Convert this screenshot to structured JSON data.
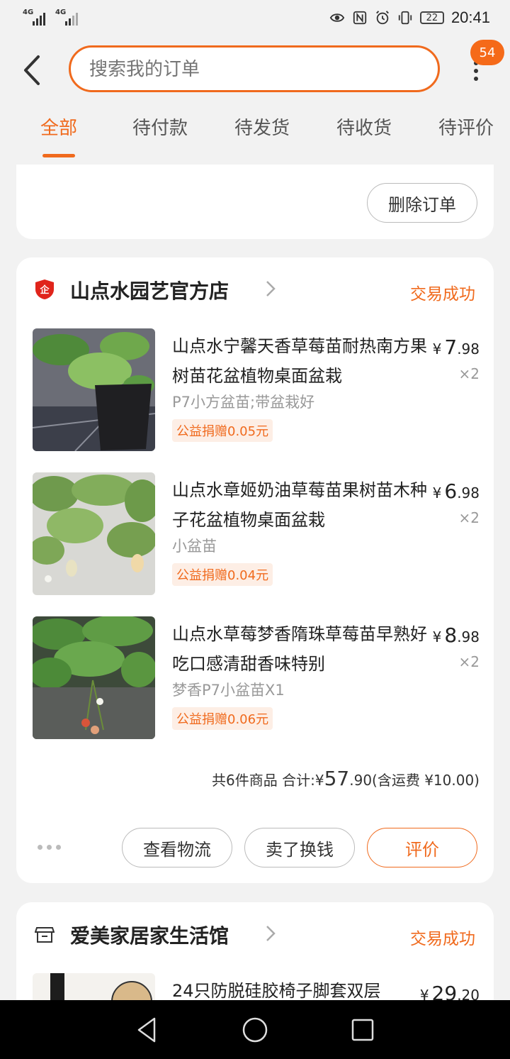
{
  "status_bar": {
    "net1": "4G",
    "net2": "4G",
    "battery": "22",
    "time": "20:41"
  },
  "header": {
    "search_placeholder": "搜索我的订单",
    "badge_count": "54"
  },
  "tabs": [
    {
      "label": "全部",
      "active": true
    },
    {
      "label": "待付款"
    },
    {
      "label": "待发货"
    },
    {
      "label": "待收货"
    },
    {
      "label": "待评价"
    }
  ],
  "prev_order": {
    "delete_button": "删除订单"
  },
  "order": {
    "shop_name": "山点水园艺官方店",
    "status": "交易成功",
    "items": [
      {
        "title": "山点水宁馨天香草莓苗耐热南方果树苗花盆植物桌面盆栽",
        "spec": "P7小方盆苗;带盆栽好",
        "donation": "公益捐赠0.05元",
        "currency": "¥",
        "price_int": "7",
        "price_dec": ".98",
        "qty": "×2"
      },
      {
        "title": "山点水章姬奶油草莓苗果树苗木种子花盆植物桌面盆栽",
        "spec": "小盆苗",
        "donation": "公益捐赠0.04元",
        "currency": "¥",
        "price_int": "6",
        "price_dec": ".98",
        "qty": "×2"
      },
      {
        "title": "山点水草莓梦香隋珠草莓苗早熟好吃口感清甜香味特别",
        "spec": "梦香P7小盆苗X1",
        "donation": "公益捐赠0.06元",
        "currency": "¥",
        "price_int": "8",
        "price_dec": ".98",
        "qty": "×2"
      }
    ],
    "summary_count": "共6件商品",
    "summary_label": "合计:",
    "summary_currency": "¥",
    "summary_int": "57",
    "summary_dec": ".90",
    "summary_shipping": "(含运费 ¥10.00)",
    "actions": {
      "logistics": "查看物流",
      "resell": "卖了换钱",
      "review": "评价"
    }
  },
  "next_order": {
    "shop_name": "爱美家居家生活馆",
    "status": "交易成功",
    "item_title": "24只防脱硅胶椅子脚套双层",
    "currency": "¥",
    "price_int": "29",
    "price_dec": ".20"
  },
  "colors": {
    "accent": "#f06a1d",
    "background": "#f2f2f2"
  }
}
